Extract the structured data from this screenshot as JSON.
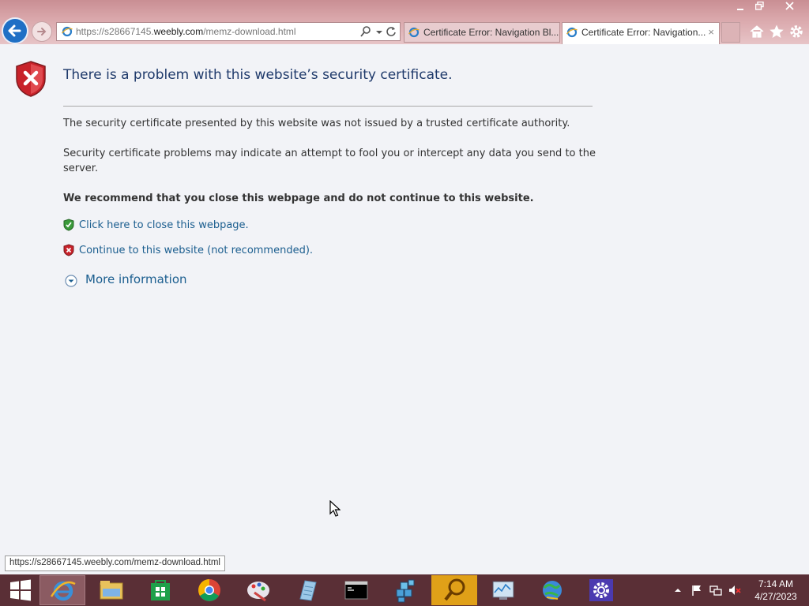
{
  "window": {
    "minimize_icon": "minimize-icon",
    "restore_icon": "restore-icon",
    "close_icon": "close-icon"
  },
  "address_bar": {
    "url_prefix": "https://s28667145.",
    "url_domain": "weebly.com",
    "url_path": "/memz-download.html"
  },
  "tabs": [
    {
      "title": "Certificate Error: Navigation Bl...",
      "active": false
    },
    {
      "title": "Certificate Error: Navigation...",
      "active": true,
      "close": "×"
    }
  ],
  "page": {
    "title": "There is a problem with this website’s security certificate.",
    "para1": "The security certificate presented by this website was not issued by a trusted certificate authority.",
    "para2": "Security certificate problems may indicate an attempt to fool you or intercept any data you send to the server.",
    "recommendation": "We recommend that you close this webpage and do not continue to this website.",
    "close_link": "Click here to close this webpage.",
    "continue_link": "Continue to this website (not recommended).",
    "more_info": "More information"
  },
  "status_tooltip": "https://s28667145.weebly.com/memz-download.html",
  "taskbar": {
    "apps": [
      "internet-explorer",
      "file-explorer",
      "store",
      "chrome",
      "paint",
      "notepad",
      "command-prompt",
      "package",
      "search-tool",
      "task-manager",
      "network-globe",
      "settings"
    ],
    "time": "7:14 AM",
    "date": "4/27/2023"
  },
  "colors": {
    "chrome_bg": "#d9a6aa",
    "link": "#1b5e8f",
    "title": "#1f3a6b",
    "taskbar": "#5a2f36"
  }
}
